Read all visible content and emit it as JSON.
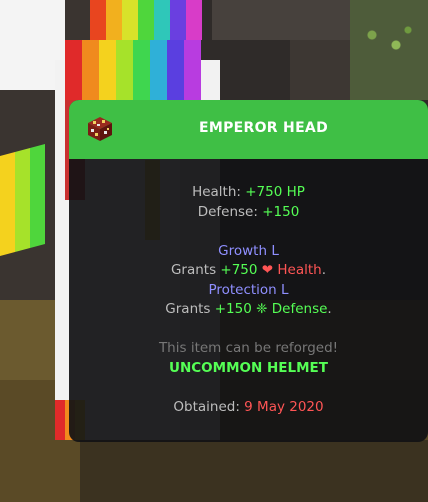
{
  "tooltip": {
    "title": "EMPEROR HEAD",
    "icon": "emperor-head-skull-icon",
    "stats": [
      {
        "label": "Health: ",
        "value": "+750 HP"
      },
      {
        "label": "Defense: ",
        "value": "+150"
      }
    ],
    "enchants": [
      {
        "name": "Growth L",
        "desc_prefix": "Grants ",
        "desc_value": "+750",
        "desc_symbol": "❤",
        "desc_stat": "Health",
        "desc_suffix": "."
      },
      {
        "name": "Protection L",
        "desc_prefix": "Grants ",
        "desc_value": "+150",
        "desc_symbol": "❈",
        "desc_stat": "Defense",
        "desc_suffix": "."
      }
    ],
    "reforge_note": "This item can be reforged!",
    "rarity": "UNCOMMON HELMET",
    "obtained_label": "Obtained: ",
    "obtained_date": "9 May 2020"
  },
  "colors": {
    "header_bg": "#3fbf45",
    "green": "#55ff55",
    "purple": "#8f8fff",
    "red": "#ff5555",
    "gray": "#bdbdbd",
    "dark_gray": "#777777"
  }
}
